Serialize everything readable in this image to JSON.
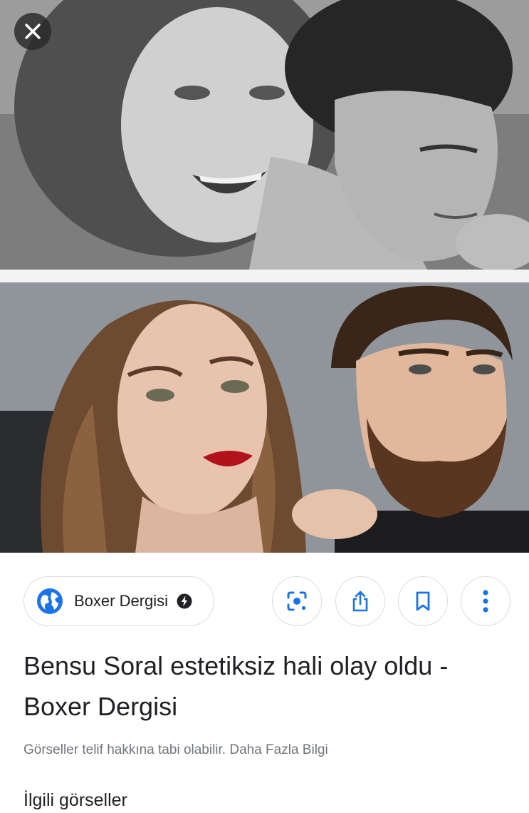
{
  "viewer": {
    "close_icon": "close-icon"
  },
  "source": {
    "name": "Boxer Dergisi",
    "favicon_icon": "globe-icon",
    "amp_icon": "amp-lightning-icon"
  },
  "actions": {
    "icons": [
      "lens-icon",
      "share-icon",
      "bookmark-icon",
      "more-vert-icon"
    ],
    "accent_color": "#1a73e8"
  },
  "result": {
    "title": "Bensu Soral estetiksiz hali olay oldu - Boxer Dergisi",
    "notice": "Görseller telif hakkına tabi olabilir. Daha Fazla Bilgi"
  },
  "related": {
    "label": "İlgili görseller"
  }
}
